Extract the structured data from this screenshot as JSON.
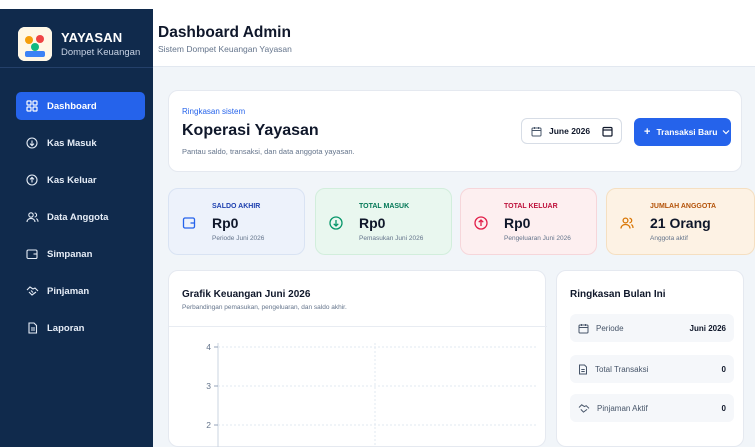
{
  "brand": {
    "name": "YAYASAN",
    "subtitle": "Dompet Keuangan"
  },
  "sidebar": {
    "items": [
      {
        "label": "Dashboard",
        "icon": "grid-icon",
        "active": true
      },
      {
        "label": "Kas Masuk",
        "icon": "arrow-down-circle-icon"
      },
      {
        "label": "Kas Keluar",
        "icon": "arrow-up-circle-icon"
      },
      {
        "label": "Data Anggota",
        "icon": "users-icon"
      },
      {
        "label": "Simpanan",
        "icon": "wallet-icon"
      },
      {
        "label": "Pinjaman",
        "icon": "handshake-icon"
      },
      {
        "label": "Laporan",
        "icon": "document-icon"
      }
    ]
  },
  "header": {
    "title": "Dashboard Admin",
    "subtitle": "Sistem Dompet Keuangan Yayasan"
  },
  "hero": {
    "eyebrow": "Ringkasan sistem",
    "title": "Koperasi Yayasan",
    "subtitle": "Pantau saldo, transaksi, dan data anggota yayasan.",
    "month_value": "June 2026",
    "new_button": "Transaksi Baru"
  },
  "stats": [
    {
      "label": "SALDO AKHIR",
      "value": "Rp0",
      "note": "Periode Juni 2026",
      "icon": "wallet-icon",
      "color": "#2563eb"
    },
    {
      "label": "TOTAL MASUK",
      "value": "Rp0",
      "note": "Pemasukan Juni 2026",
      "icon": "arrow-down-circle-icon",
      "color": "#059669"
    },
    {
      "label": "TOTAL KELUAR",
      "value": "Rp0",
      "note": "Pengeluaran Juni 2026",
      "icon": "arrow-up-circle-icon",
      "color": "#e11d48"
    },
    {
      "label": "JUMLAH ANGGOTA",
      "value": "21 Orang",
      "note": "Anggota aktif",
      "icon": "users-icon",
      "color": "#d97706"
    }
  ],
  "chart_card": {
    "title": "Grafik Keuangan Juni 2026",
    "subtitle": "Perbandingan pemasukan, pengeluaran, dan saldo akhir."
  },
  "chart_data": {
    "type": "line",
    "y_ticks": [
      "4",
      "3",
      "2"
    ],
    "grid": true
  },
  "summary": {
    "title": "Ringkasan Bulan Ini",
    "rows": [
      {
        "label": "Periode",
        "value": "Juni 2026",
        "icon": "calendar-icon"
      },
      {
        "label": "Total Transaksi",
        "value": "0",
        "icon": "document-icon"
      },
      {
        "label": "Pinjaman Aktif",
        "value": "0",
        "icon": "handshake-icon"
      }
    ]
  }
}
